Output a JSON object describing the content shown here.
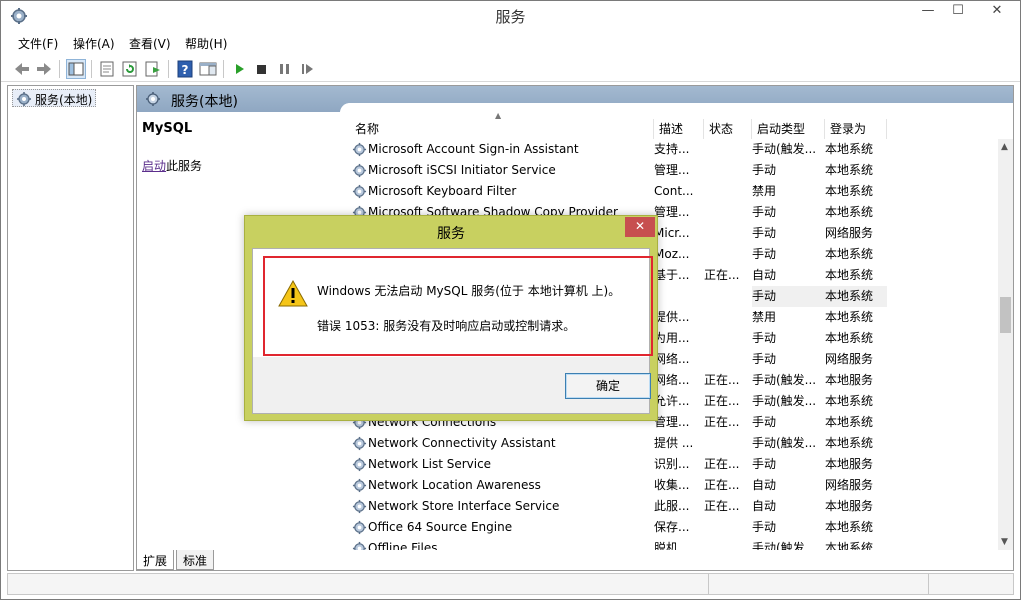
{
  "window": {
    "title": "服务"
  },
  "menubar": {
    "items": [
      {
        "label": "文件(F)"
      },
      {
        "label": "操作(A)"
      },
      {
        "label": "查看(V)"
      },
      {
        "label": "帮助(H)"
      }
    ]
  },
  "tree": {
    "root_label": "服务(本地)"
  },
  "content": {
    "header_title": "服务(本地)",
    "selected_service": "MySQL",
    "start_link": "启动",
    "start_suffix": "此服务"
  },
  "columns": {
    "name": "名称",
    "description": "描述",
    "status": "状态",
    "startup": "启动类型",
    "logon": "登录为"
  },
  "services": [
    {
      "name": "Microsoft Account Sign-in Assistant",
      "desc": "支持...",
      "status": "",
      "startup": "手动(触发...",
      "logon": "本地系统"
    },
    {
      "name": "Microsoft iSCSI Initiator Service",
      "desc": "管理...",
      "status": "",
      "startup": "手动",
      "logon": "本地系统"
    },
    {
      "name": "Microsoft Keyboard Filter",
      "desc": "Cont...",
      "status": "",
      "startup": "禁用",
      "logon": "本地系统"
    },
    {
      "name": "Microsoft Software Shadow Copy Provider",
      "desc": "管理...",
      "status": "",
      "startup": "手动",
      "logon": "本地系统"
    },
    {
      "name": "",
      "desc": "Micr...",
      "status": "",
      "startup": "手动",
      "logon": "网络服务"
    },
    {
      "name": "",
      "desc": "Moz...",
      "status": "",
      "startup": "手动",
      "logon": "本地系统"
    },
    {
      "name": "",
      "desc": "基于...",
      "status": "正在...",
      "startup": "自动",
      "logon": "本地系统"
    },
    {
      "name": "",
      "desc": "",
      "status": "",
      "startup": "手动",
      "logon": "本地系统"
    },
    {
      "name": "",
      "desc": "提供...",
      "status": "",
      "startup": "禁用",
      "logon": "本地系统"
    },
    {
      "name": "",
      "desc": "为用...",
      "status": "",
      "startup": "手动",
      "logon": "本地系统"
    },
    {
      "name": "",
      "desc": "网络...",
      "status": "",
      "startup": "手动",
      "logon": "网络服务"
    },
    {
      "name": "",
      "desc": "网络...",
      "status": "正在...",
      "startup": "手动(触发...",
      "logon": "本地服务"
    },
    {
      "name": "",
      "desc": "允许...",
      "status": "正在...",
      "startup": "手动(触发...",
      "logon": "本地系统"
    },
    {
      "name": "Network Connections",
      "desc": "管理...",
      "status": "正在...",
      "startup": "手动",
      "logon": "本地系统"
    },
    {
      "name": "Network Connectivity Assistant",
      "desc": "提供 ...",
      "status": "",
      "startup": "手动(触发...",
      "logon": "本地系统"
    },
    {
      "name": "Network List Service",
      "desc": "识别...",
      "status": "正在...",
      "startup": "手动",
      "logon": "本地服务"
    },
    {
      "name": "Network Location Awareness",
      "desc": "收集...",
      "status": "正在...",
      "startup": "自动",
      "logon": "网络服务"
    },
    {
      "name": "Network Store Interface Service",
      "desc": "此服...",
      "status": "正在...",
      "startup": "自动",
      "logon": "本地服务"
    },
    {
      "name": "Office 64 Source Engine",
      "desc": "保存...",
      "status": "",
      "startup": "手动",
      "logon": "本地系统"
    },
    {
      "name": "Offline Files",
      "desc": "脱机...",
      "status": "",
      "startup": "手动(触发...",
      "logon": "本地系统"
    }
  ],
  "tabs": {
    "extended": "扩展",
    "standard": "标准"
  },
  "dialog": {
    "title": "服务",
    "message": "Windows 无法启动 MySQL 服务(位于 本地计算机 上)。",
    "error": "错误 1053: 服务没有及时响应启动或控制请求。",
    "ok_label": "确定"
  },
  "colors": {
    "dialog_frame": "#c8d060",
    "highlight_box": "#e0262f",
    "content_header": "#a3b9d0",
    "close_button": "#c74f4f"
  }
}
